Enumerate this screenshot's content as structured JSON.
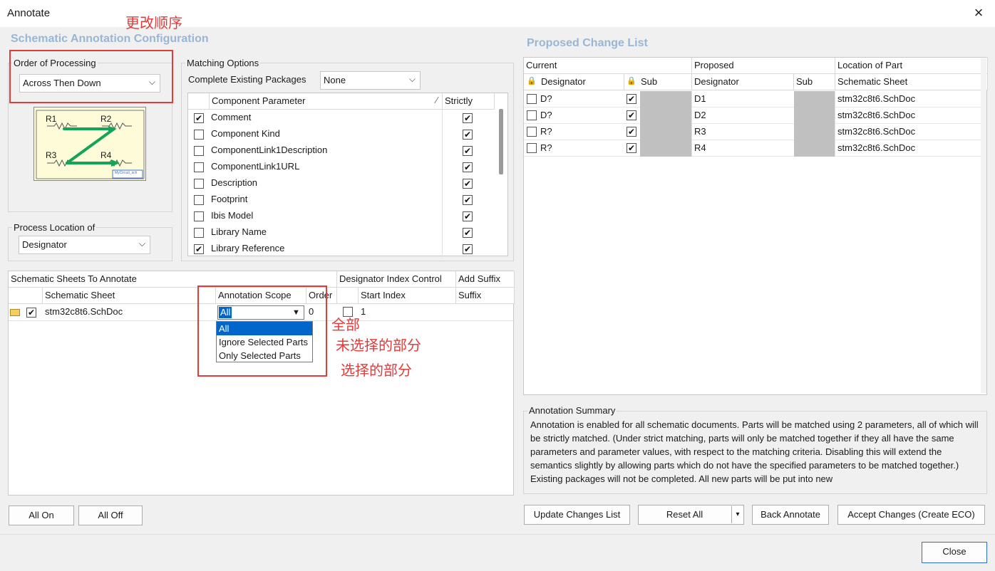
{
  "window": {
    "title": "Annotate",
    "close_label": "×"
  },
  "left": {
    "section_title": "Schematic Annotation Configuration",
    "order_group": {
      "label": "Order of Processing",
      "value": "Across Then Down"
    },
    "diagram": {
      "r1": "R1",
      "r2": "R2",
      "r3": "R3",
      "r4": "R4",
      "footer": "MyCircuit_sch"
    },
    "process_group": {
      "label": "Process Location of",
      "value": "Designator"
    },
    "matching": {
      "label": "Matching Options",
      "packages_label": "Complete Existing Packages",
      "packages_value": "None",
      "col_param": "Component Parameter",
      "col_strict": "Strictly",
      "rows": [
        {
          "name": "Comment",
          "checked": true,
          "strict": true
        },
        {
          "name": "Component Kind",
          "checked": false,
          "strict": true
        },
        {
          "name": "ComponentLink1Description",
          "checked": false,
          "strict": true
        },
        {
          "name": "ComponentLink1URL",
          "checked": false,
          "strict": true
        },
        {
          "name": "Description",
          "checked": false,
          "strict": true
        },
        {
          "name": "Footprint",
          "checked": false,
          "strict": true
        },
        {
          "name": "Ibis Model",
          "checked": false,
          "strict": true
        },
        {
          "name": "Library Name",
          "checked": false,
          "strict": true
        },
        {
          "name": "Library Reference",
          "checked": true,
          "strict": true
        }
      ]
    },
    "sheets": {
      "header": "Schematic Sheets To Annotate",
      "index_header": "Designator Index Control",
      "suffix_header": "Add Suffix",
      "col_sheet": "Schematic Sheet",
      "col_scope": "Annotation Scope",
      "col_order": "Order",
      "col_start": "Start Index",
      "col_suffix": "Suffix",
      "row": {
        "sheet": "stm32c8t6.SchDoc",
        "scope": "All",
        "order": "0",
        "start": "1"
      },
      "dropdown_options": [
        "All",
        "Ignore Selected Parts",
        "Only Selected Parts"
      ]
    },
    "all_on": "All On",
    "all_off": "All Off"
  },
  "annotations": {
    "order_note": "更改顺序",
    "all_note": "全部",
    "ignore_note": "未选择的部分",
    "only_note": "选择的部分"
  },
  "right": {
    "section_title": "Proposed Change List",
    "groups": {
      "current": "Current",
      "proposed": "Proposed",
      "location": "Location of Part"
    },
    "cols": {
      "designator": "Designator",
      "sub": "Sub",
      "p_designator": "Designator",
      "p_sub": "Sub",
      "sheet": "Schematic Sheet"
    },
    "rows": [
      {
        "current": "D?",
        "proposed": "D1",
        "sheet": "stm32c8t6.SchDoc"
      },
      {
        "current": "D?",
        "proposed": "D2",
        "sheet": "stm32c8t6.SchDoc"
      },
      {
        "current": "R?",
        "proposed": "R3",
        "sheet": "stm32c8t6.SchDoc"
      },
      {
        "current": "R?",
        "proposed": "R4",
        "sheet": "stm32c8t6.SchDoc"
      }
    ],
    "summary_label": "Annotation Summary",
    "summary_text": "Annotation is enabled for all schematic documents. Parts will be matched using 2 parameters, all of which will be strictly matched. (Under strict matching, parts will only be matched together if they all have the same parameters and parameter values, with respect to the matching criteria. Disabling this will extend the semantics slightly by allowing parts which do not have the specified parameters to be matched together.) Existing packages will not be completed. All new parts will be put into new",
    "update_btn": "Update Changes List",
    "reset_btn": "Reset All",
    "back_btn": "Back Annotate",
    "accept_btn": "Accept Changes (Create ECO)"
  },
  "footer": {
    "close_btn": "Close"
  }
}
